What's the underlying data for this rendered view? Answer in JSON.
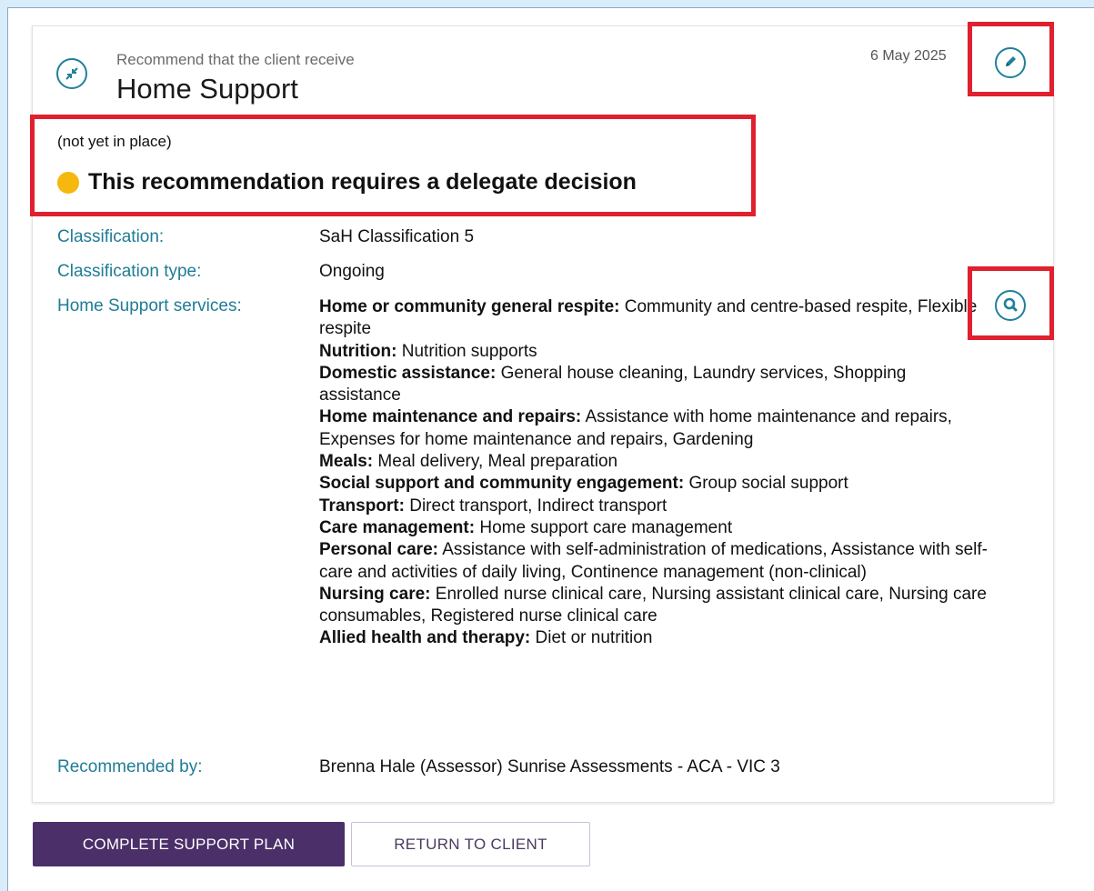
{
  "card": {
    "subtitle": "Recommend that the client receive",
    "title": "Home Support",
    "date": "6 May 2025",
    "type_icon": "compress-arrows-icon",
    "edit_icon": "pencil-icon",
    "view_icon": "magnifier-icon"
  },
  "status": {
    "line": "(not yet in place)",
    "delegate_text": "This recommendation requires a delegate decision",
    "dot_color": "#f6b80e"
  },
  "details": {
    "classification_label": "Classification:",
    "classification_value": "SaH Classification 5",
    "classification_type_label": "Classification type:",
    "classification_type_value": "Ongoing",
    "services_label": "Home Support services:",
    "services": [
      {
        "name": "Home or community general respite:",
        "items": "Community and centre-based respite, Flexible respite"
      },
      {
        "name": "Nutrition:",
        "items": "Nutrition supports"
      },
      {
        "name": "Domestic assistance:",
        "items": "General house cleaning, Laundry services, Shopping assistance"
      },
      {
        "name": "Home maintenance and repairs:",
        "items": "Assistance with home maintenance and repairs, Expenses for home maintenance and repairs, Gardening"
      },
      {
        "name": "Meals:",
        "items": "Meal delivery, Meal preparation"
      },
      {
        "name": "Social support and community engagement:",
        "items": "Group social support"
      },
      {
        "name": "Transport:",
        "items": "Direct transport, Indirect transport"
      },
      {
        "name": "Care management:",
        "items": "Home support care management"
      },
      {
        "name": "Personal care:",
        "items": "Assistance with self-administration of medications, Assistance with self-care and activities of daily living, Continence management (non-clinical)"
      },
      {
        "name": "Nursing care:",
        "items": "Enrolled nurse clinical care, Nursing assistant clinical care, Nursing care consumables, Registered nurse clinical care"
      },
      {
        "name": "Allied health and therapy:",
        "items": "Diet or nutrition"
      }
    ],
    "recommended_by_label": "Recommended by:",
    "recommended_by_value": "Brenna Hale (Assessor) Sunrise Assessments - ACA - VIC 3"
  },
  "actions": {
    "complete_label": "COMPLETE SUPPORT PLAN",
    "return_label": "RETURN TO CLIENT"
  },
  "colors": {
    "accent": "#1f8098",
    "label": "#1f7c96",
    "primary_button": "#4a2f68",
    "highlight": "#e0202e",
    "background": "#d9ecf9"
  }
}
